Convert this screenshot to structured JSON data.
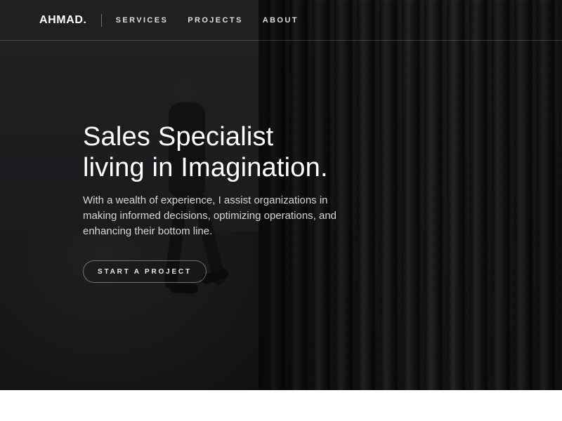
{
  "brand": {
    "name": "AHMAD."
  },
  "nav": {
    "links": [
      {
        "label": "SERVICES"
      },
      {
        "label": "PROJECTS"
      },
      {
        "label": "ABOUT"
      }
    ]
  },
  "hero": {
    "headline": {
      "line1": "Sales Specialist",
      "line2": "living in Imagination."
    },
    "description": "With a wealth of experience, I assist organizations in making informed decisions, optimizing operations, and enhancing their bottom line.",
    "cta_label": "START A PROJECT"
  },
  "colors": {
    "hero_text": "#ffffff",
    "nav_text": "#e6e6e6",
    "divider": "#ffffff",
    "hero_bg": "#1f1f22",
    "page_bg": "#ffffff"
  }
}
